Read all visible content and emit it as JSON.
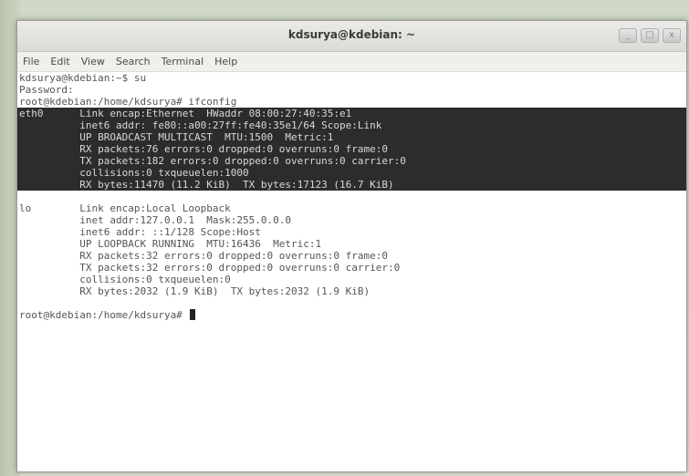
{
  "window": {
    "title": "kdsurya@kdebian: ~",
    "controls": [
      "_",
      "□",
      "x"
    ]
  },
  "menu": [
    "File",
    "Edit",
    "View",
    "Search",
    "Terminal",
    "Help"
  ],
  "terminal": {
    "pre": [
      "kdsurya@kdebian:~$ su",
      "Password:",
      "root@kdebian:/home/kdsurya# ifconfig"
    ],
    "eth0": [
      "eth0      Link encap:Ethernet  HWaddr 08:00:27:40:35:e1",
      "          inet6 addr: fe80::a00:27ff:fe40:35e1/64 Scope:Link",
      "          UP BROADCAST MULTICAST  MTU:1500  Metric:1",
      "          RX packets:76 errors:0 dropped:0 overruns:0 frame:0",
      "          TX packets:182 errors:0 dropped:0 overruns:0 carrier:0",
      "          collisions:0 txqueuelen:1000",
      "          RX bytes:11470 (11.2 KiB)  TX bytes:17123 (16.7 KiB)"
    ],
    "lo": [
      "lo        Link encap:Local Loopback",
      "          inet addr:127.0.0.1  Mask:255.0.0.0",
      "          inet6 addr: ::1/128 Scope:Host",
      "          UP LOOPBACK RUNNING  MTU:16436  Metric:1",
      "          RX packets:32 errors:0 dropped:0 overruns:0 frame:0",
      "          TX packets:32 errors:0 dropped:0 overruns:0 carrier:0",
      "          collisions:0 txqueuelen:0",
      "          RX bytes:2032 (1.9 KiB)  TX bytes:2032 (1.9 KiB)"
    ],
    "prompt": "root@kdebian:/home/kdsurya# "
  }
}
